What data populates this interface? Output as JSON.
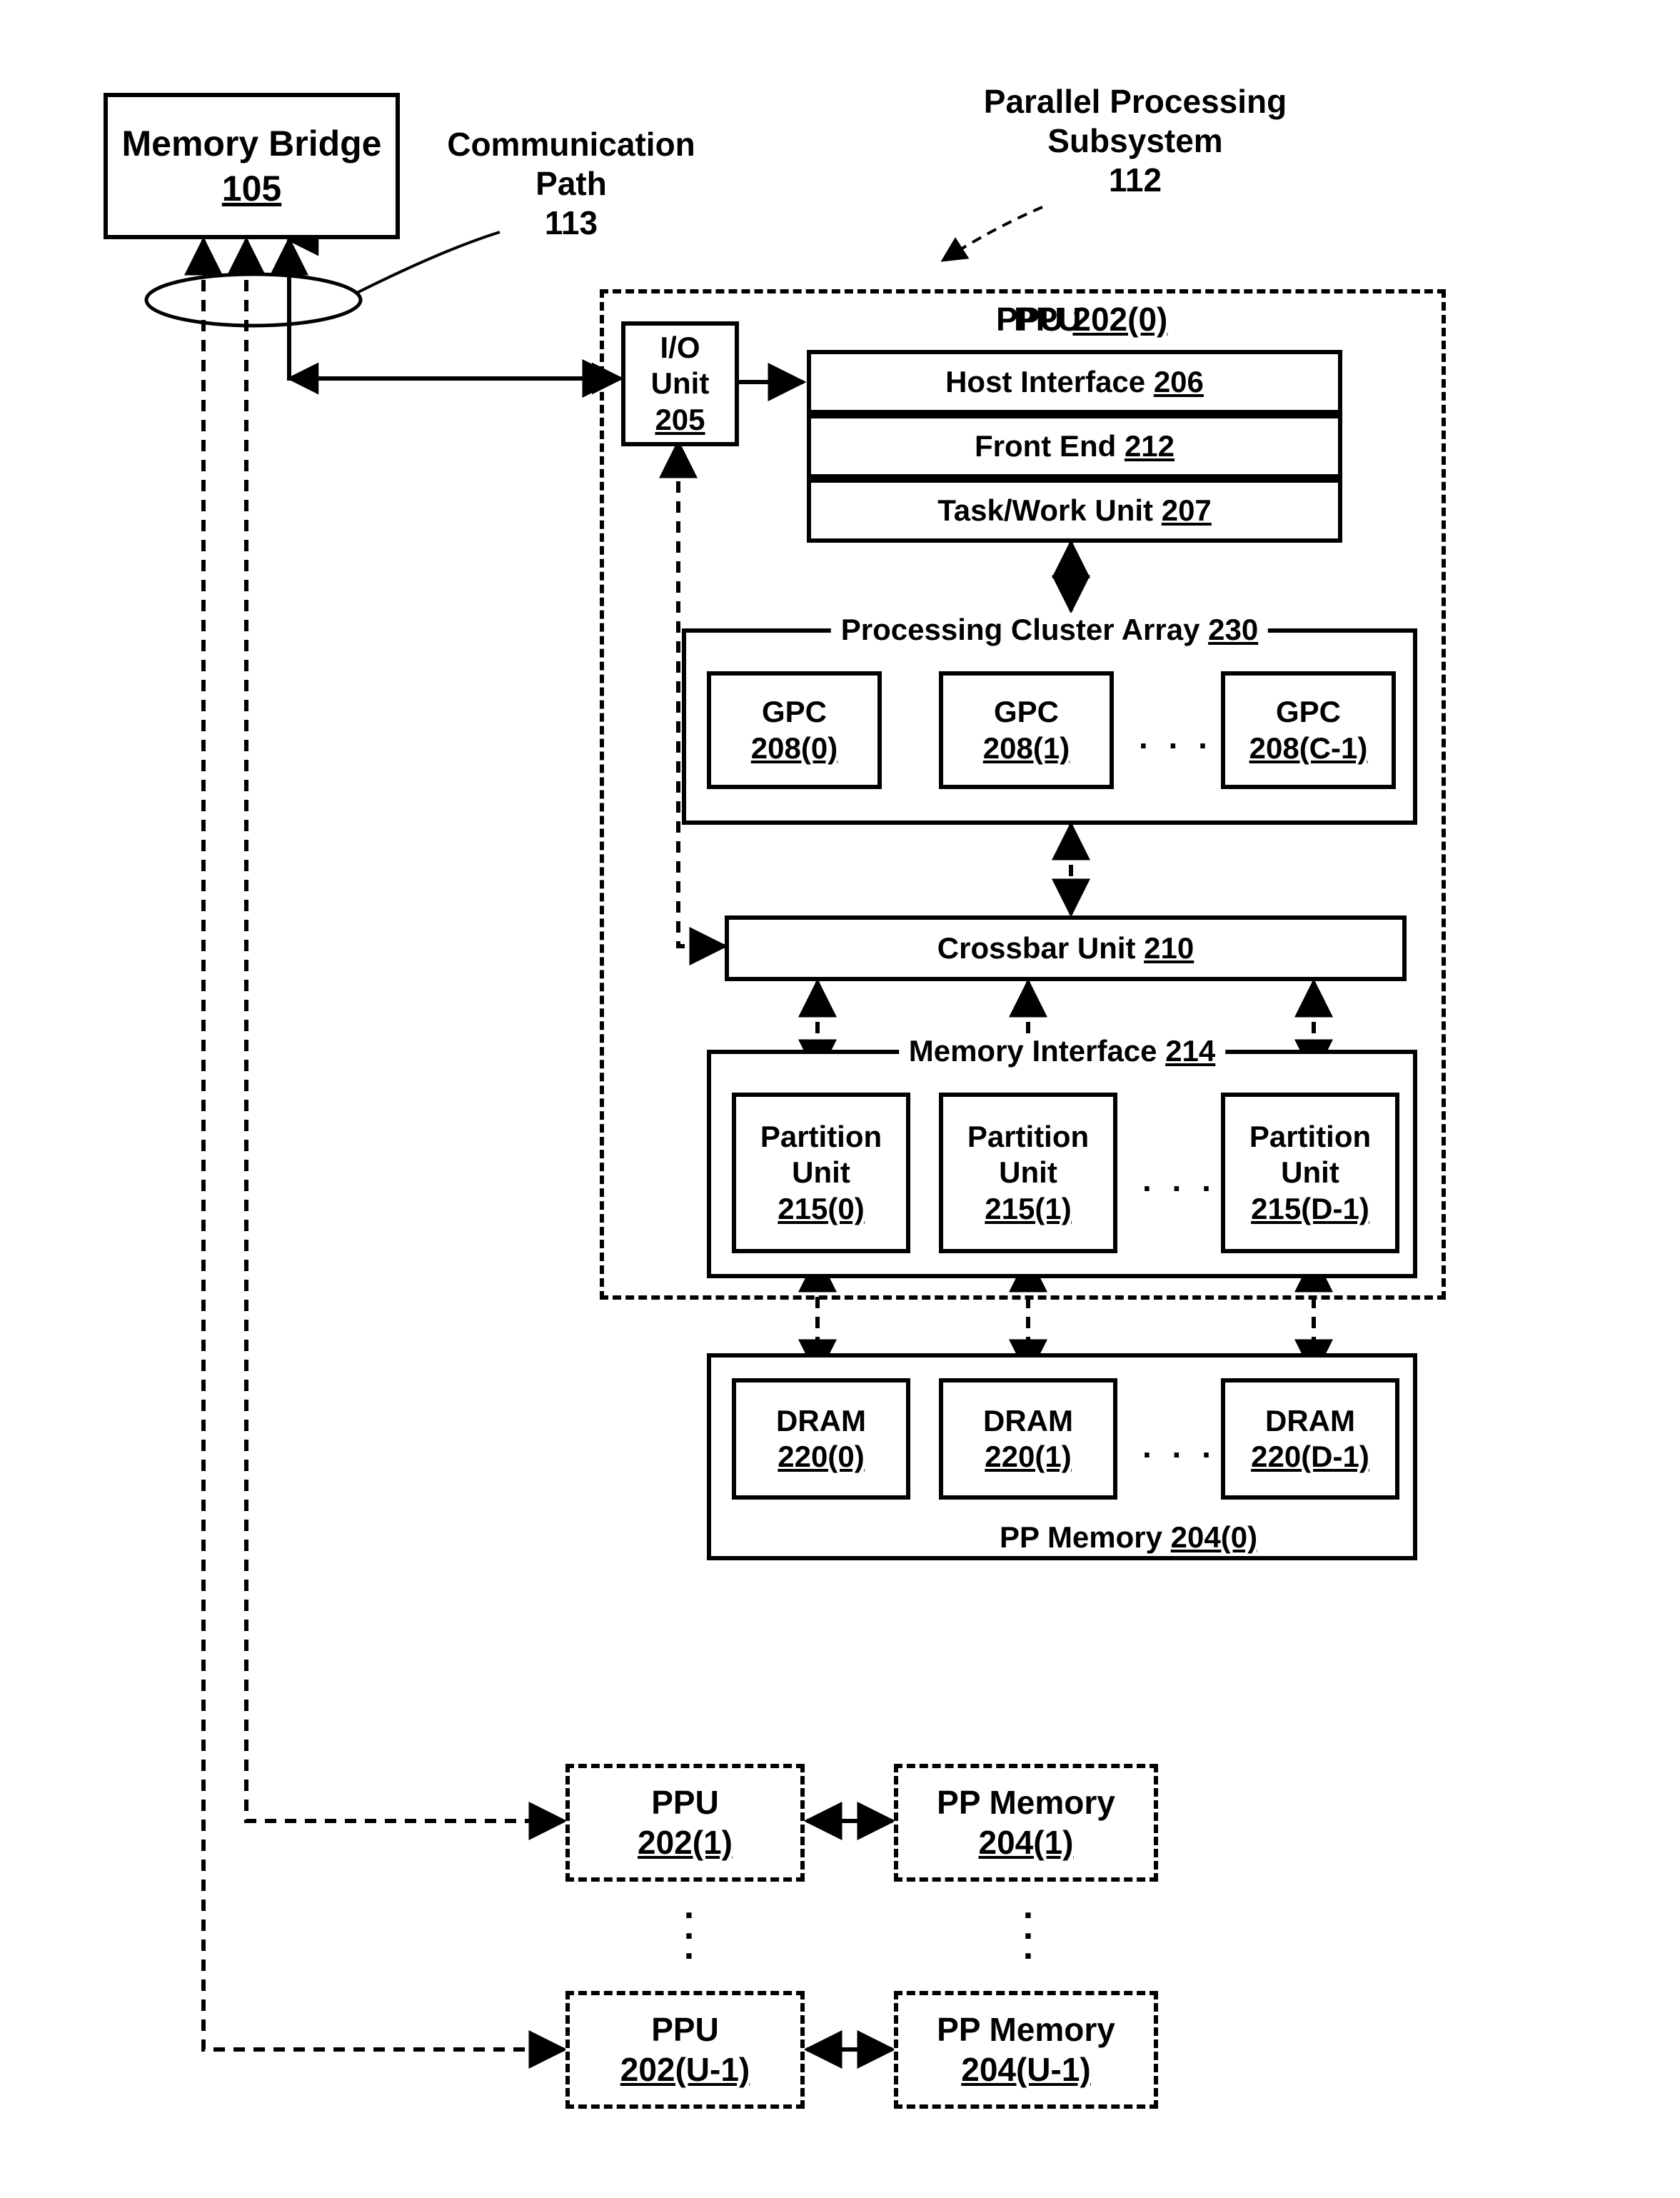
{
  "memory_bridge": {
    "name": "Memory Bridge",
    "ref": "105"
  },
  "comm_path": {
    "name": "Communication",
    "name2": "Path",
    "ref": "113"
  },
  "subsystem": {
    "name": "Parallel Processing",
    "name2": "Subsystem",
    "ref": "112"
  },
  "ppu0": {
    "title": "PPU 202(0)"
  },
  "io_unit": {
    "l1": "I/O",
    "l2": "Unit",
    "ref": "205"
  },
  "host_if": {
    "text": "Host Interface ",
    "ref": "206"
  },
  "front_end": {
    "text": "Front End ",
    "ref": "212"
  },
  "task_work": {
    "text": "Task/Work Unit ",
    "ref": "207"
  },
  "pca": {
    "text": "Processing Cluster Array ",
    "ref": "230"
  },
  "gpc0": {
    "name": "GPC",
    "ref": "208(0)"
  },
  "gpc1": {
    "name": "GPC",
    "ref": "208(1)"
  },
  "gpcC": {
    "name": "GPC",
    "ref": "208(C-1)"
  },
  "crossbar": {
    "text": "Crossbar Unit ",
    "ref": "210"
  },
  "mem_if": {
    "text": "Memory Interface ",
    "ref": "214"
  },
  "pu0": {
    "l1": "Partition",
    "l2": "Unit",
    "ref": "215(0)"
  },
  "pu1": {
    "l1": "Partition",
    "l2": "Unit",
    "ref": "215(1)"
  },
  "puD": {
    "l1": "Partition",
    "l2": "Unit",
    "ref": "215(D-1)"
  },
  "ppmem0": {
    "text": "PP Memory ",
    "ref": "204(0)"
  },
  "dram0": {
    "name": "DRAM",
    "ref": "220(0)"
  },
  "dram1": {
    "name": "DRAM",
    "ref": "220(1)"
  },
  "dramD": {
    "name": "DRAM",
    "ref": "220(D-1)"
  },
  "ppu1": {
    "name": "PPU",
    "ref": "202(1)"
  },
  "ppmem1": {
    "name": "PP Memory",
    "ref": "204(1)"
  },
  "ppuU": {
    "name": "PPU",
    "ref": "202(U-1)"
  },
  "ppmemU": {
    "name": "PP Memory",
    "ref": "204(U-1)"
  },
  "dotsH": ". . .",
  "dotV1": ".",
  "dotV2": ".",
  "dotV3": "."
}
